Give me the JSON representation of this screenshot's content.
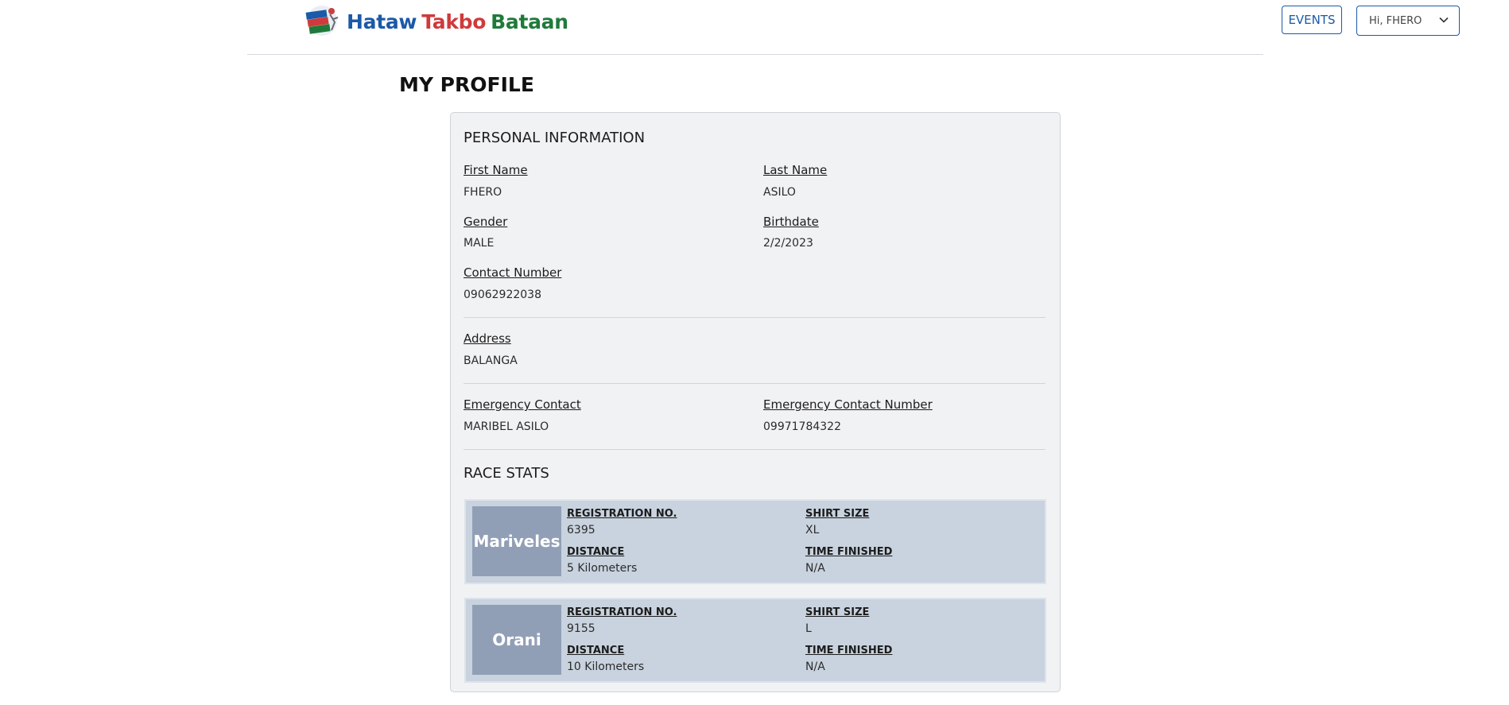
{
  "header": {
    "brand": {
      "word1": "Hataw",
      "word2": "Takbo",
      "word3": "Bataan",
      "colors": {
        "word1": "#1a5aa8",
        "word2": "#d03a3a",
        "word3": "#1f7a3a"
      }
    },
    "events_label": "EVENTS",
    "user_menu": {
      "selected": "Hi, FHERO",
      "icon": "chevron-down-icon"
    }
  },
  "page": {
    "title": "MY PROFILE"
  },
  "personal": {
    "title": "PERSONAL INFORMATION",
    "first_name": {
      "label": "First Name",
      "value": "FHERO"
    },
    "last_name": {
      "label": "Last Name",
      "value": "ASILO"
    },
    "gender": {
      "label": "Gender",
      "value": "MALE"
    },
    "birthdate": {
      "label": "Birthdate",
      "value": "2/2/2023"
    },
    "contact": {
      "label": "Contact Number",
      "value": "09062922038"
    },
    "address": {
      "label": "Address",
      "value": "BALANGA"
    },
    "emergency_contact": {
      "label": "Emergency Contact",
      "value": "MARIBEL ASILO"
    },
    "emergency_number": {
      "label": "Emergency Contact Number",
      "value": "09971784322"
    }
  },
  "race_stats": {
    "title": "RACE STATS",
    "labels": {
      "registration": "REGISTRATION NO.",
      "shirt": "SHIRT SIZE",
      "distance": "DISTANCE",
      "time": "TIME FINISHED"
    },
    "races": [
      {
        "city": "Mariveles",
        "registration": "6395",
        "shirt": "XL",
        "distance": "5 Kilometers",
        "time": "N/A"
      },
      {
        "city": "Orani",
        "registration": "9155",
        "shirt": "L",
        "distance": "10 Kilometers",
        "time": "N/A"
      }
    ]
  }
}
